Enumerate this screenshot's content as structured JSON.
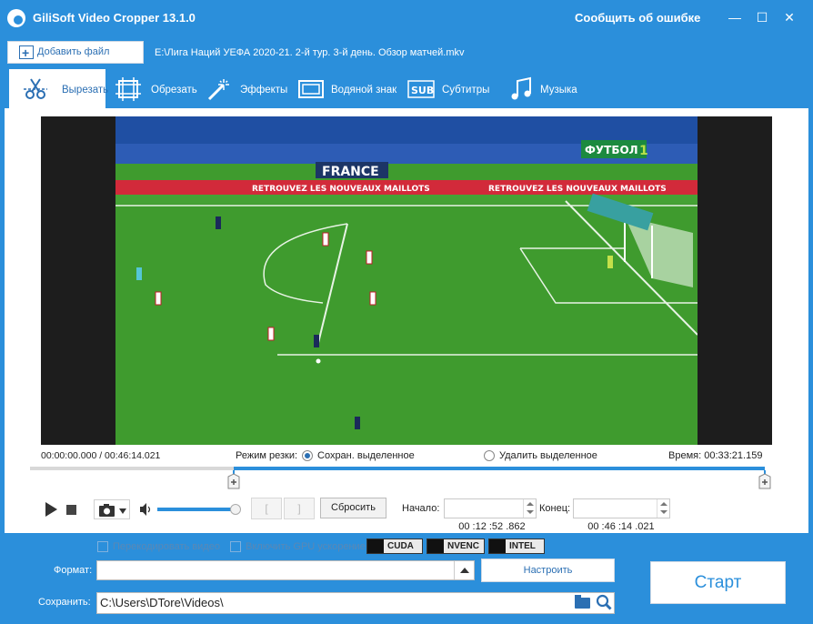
{
  "window": {
    "title": "GiliSoft Video Cropper 13.1.0",
    "report_link": "Сообщить об ошибке",
    "min": "—",
    "max": "☐",
    "close": "✕"
  },
  "file": {
    "add_label": "Добавить файл",
    "path": "E:\\Лига Наций УЕФА 2020-21. 2-й тур. 3-й день. Обзор матчей.mkv"
  },
  "tabs": [
    {
      "label": "Вырезать",
      "icon": "scissors-icon",
      "active": true
    },
    {
      "label": "Обрезать",
      "icon": "crop-icon"
    },
    {
      "label": "Эффекты",
      "icon": "magic-wand-icon"
    },
    {
      "label": "Водяной знак",
      "icon": "watermark-icon"
    },
    {
      "label": "Субтитры",
      "icon": "subtitles-icon"
    },
    {
      "label": "Музыка",
      "icon": "music-icon"
    }
  ],
  "video": {
    "overlay_text": "FRANCE",
    "channel": "ФУТБОЛ",
    "channel_num": "1",
    "ad_text": "RETROUVEZ LES NOUVEAUX MAILLOTS"
  },
  "player": {
    "time": "00:00:00.000 / 00:46:14.021",
    "mode_label": "Режим резки:",
    "option_keep": "Сохран. выделенное",
    "option_delete": "Удалить выделенное",
    "duration": "Время: 00:33:21.159",
    "selection_start_fraction": 0.277,
    "selection_end_fraction": 1.0,
    "volume_fraction": 0.95,
    "bracket_left": "[",
    "bracket_right": "]",
    "reset_label": "Сбросить",
    "start_label": "Начало:",
    "start_value": "00 :12 :52 .862",
    "end_label": "Конец:",
    "end_value": "00 :46 :14 .021"
  },
  "output": {
    "reencode_label": "Перекодировать видео",
    "gpu_label": "Включить GPU ускорение",
    "badges": [
      "CUDA",
      "NVENC",
      "INTEL"
    ],
    "format_label": "Формат:",
    "format_value": "",
    "settings_label": "Настроить",
    "save_label": "Сохранить:",
    "save_path": "C:\\Users\\DTore\\Videos\\",
    "start_button": "Старт"
  },
  "colors": {
    "accent": "#2b8fdb",
    "pitch": "#3f9b2e",
    "selection": "#2b8fdb"
  }
}
